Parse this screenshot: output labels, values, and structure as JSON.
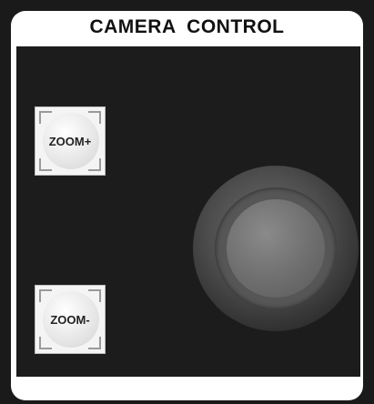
{
  "panel": {
    "title": "CAMERA CONTROL"
  },
  "controls": {
    "zoom_in_label": "ZOOM+",
    "zoom_out_label": "ZOOM-",
    "joystick_icon": "joystick-icon"
  },
  "colors": {
    "panel_background": "#1c1c1c",
    "button_face": "#f4f4f4",
    "joystick": "#4c4c4c"
  }
}
